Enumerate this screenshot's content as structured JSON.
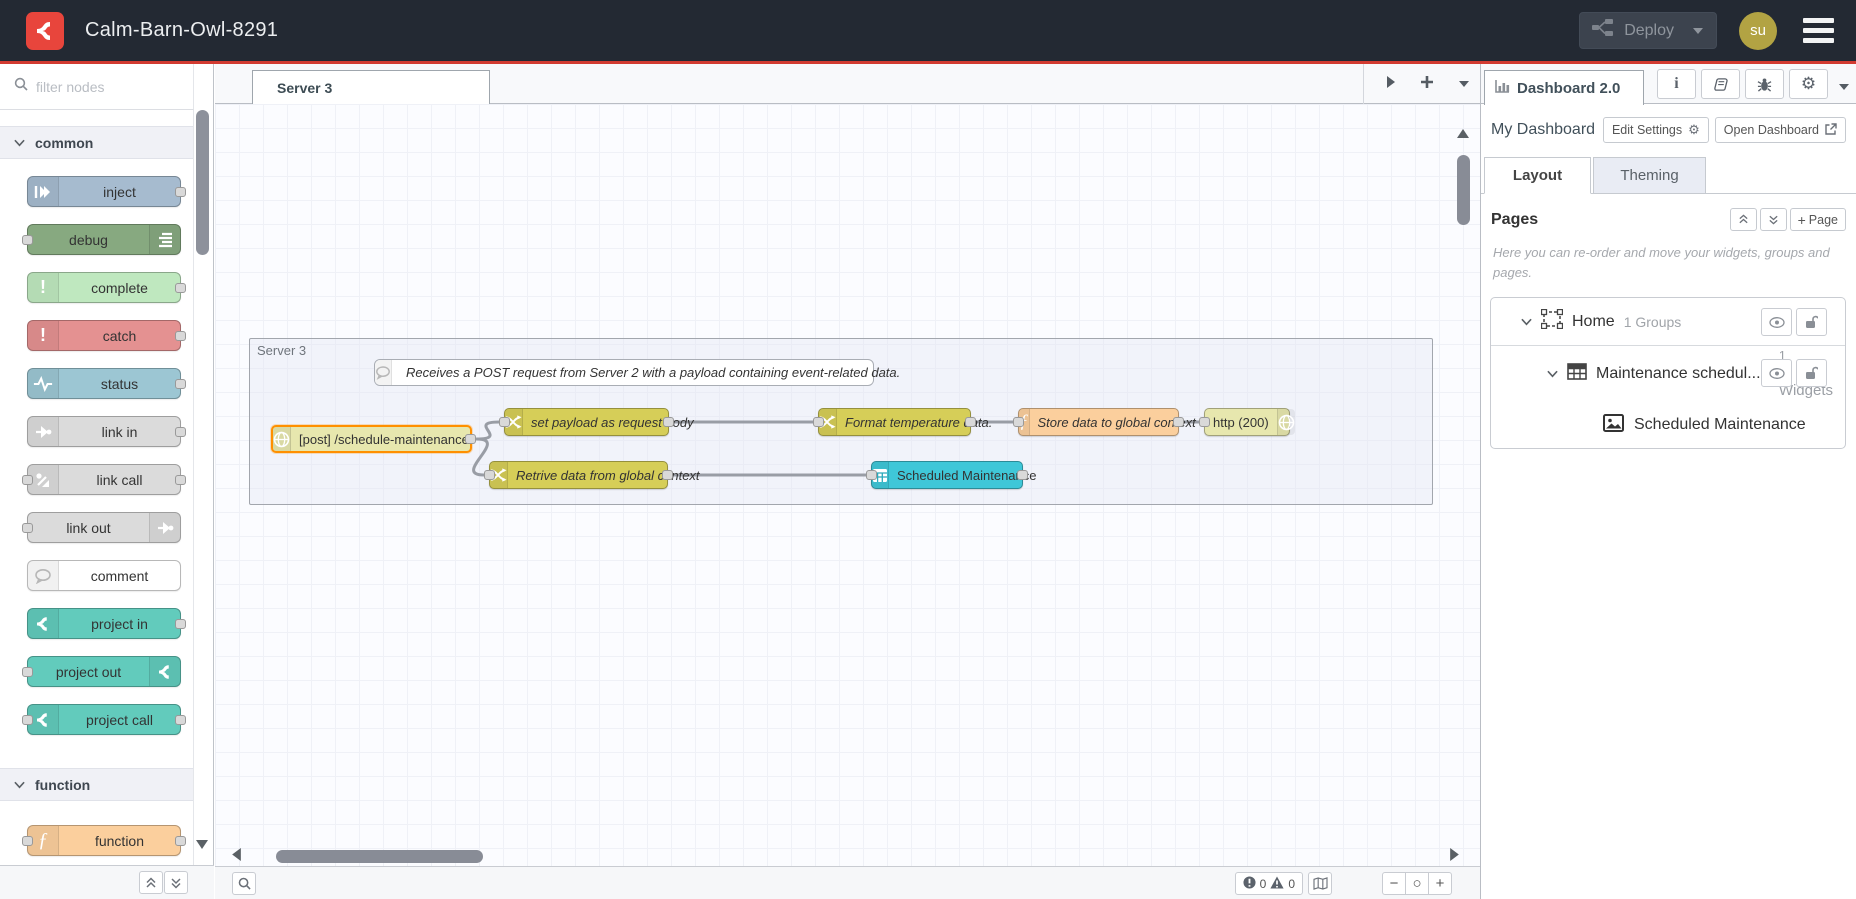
{
  "header": {
    "title": "Calm-Barn-Owl-8291",
    "deploy_label": "Deploy",
    "user_initials": "su"
  },
  "palette": {
    "filter_placeholder": "filter nodes",
    "categories": [
      {
        "label": "common",
        "nodes": [
          {
            "label": "inject",
            "color": "#a6bbcf",
            "icon": "arrow-in-icon"
          },
          {
            "label": "debug",
            "color": "#87a980",
            "icon": "list-icon"
          },
          {
            "label": "complete",
            "color": "#bfe8bf",
            "icon": "exclamation-icon"
          },
          {
            "label": "catch",
            "color": "#e49191",
            "icon": "exclamation-icon"
          },
          {
            "label": "status",
            "color": "#9cc6d3",
            "icon": "pulse-icon"
          },
          {
            "label": "link in",
            "color": "#dbdbdb",
            "icon": "link-arrow-icon"
          },
          {
            "label": "link call",
            "color": "#dbdbdb",
            "icon": "link-arrow-icon"
          },
          {
            "label": "link out",
            "color": "#dbdbdb",
            "icon": "link-arrow-icon"
          },
          {
            "label": "comment",
            "color": "#ffffff",
            "icon": "speech-bubble-icon"
          },
          {
            "label": "project in",
            "color": "#62cbbc",
            "icon": "node-red-logo-icon"
          },
          {
            "label": "project out",
            "color": "#62cbbc",
            "icon": "node-red-logo-icon"
          },
          {
            "label": "project call",
            "color": "#62cbbc",
            "icon": "node-red-logo-icon"
          }
        ]
      },
      {
        "label": "function",
        "nodes": [
          {
            "label": "function",
            "color": "#fbcf9d",
            "icon": "function-icon"
          }
        ]
      }
    ]
  },
  "workspace": {
    "tab_label": "Server 3",
    "group_label": "Server 3",
    "comment_text": "Receives a POST request from Server 2 with a payload containing event-related data.",
    "nodes": [
      {
        "label": "[post] /schedule-maintenance",
        "color": "#e7e7ae",
        "icon": "globe-icon",
        "selected": true
      },
      {
        "label": "set payload as request body",
        "color": "#d6ce58",
        "icon": "shuffle-icon"
      },
      {
        "label": "Format temperature data.",
        "color": "#d6ce58",
        "icon": "shuffle-icon"
      },
      {
        "label": "Store data to global context",
        "color": "#fbcf9d",
        "icon": "function-icon"
      },
      {
        "label": "http (200)",
        "color": "#e7e7ae",
        "icon": "globe-icon"
      },
      {
        "label": "Retrive data from global context",
        "color": "#d6ce58",
        "icon": "shuffle-icon"
      },
      {
        "label": "Scheduled Maintenance",
        "color": "#3fc7d8",
        "icon": "table-icon"
      }
    ],
    "footer": {
      "error_count": "0",
      "warning_count": "0",
      "zoom_out": "−",
      "zoom_reset": "○",
      "zoom_in": "+"
    }
  },
  "sidebar": {
    "tab_label": "Dashboard 2.0",
    "dashboard_title": "My Dashboard",
    "edit_settings_label": "Edit Settings",
    "open_dashboard_label": "Open Dashboard",
    "tabs": {
      "layout": "Layout",
      "theming": "Theming"
    },
    "pages_title": "Pages",
    "add_page_label": "Page",
    "add_page_plus": "+",
    "help_text": "Here you can re-order and move your widgets, groups and pages.",
    "tree": {
      "page": {
        "label": "Home",
        "meta": "1 Groups"
      },
      "group": {
        "label": "Maintenance schedul...",
        "count": "1",
        "count_word": "Widgets"
      },
      "widget": {
        "label": "Scheduled Maintenance"
      }
    }
  },
  "icons": {
    "logo": "node-red-logo",
    "deploy": "deploy-nodes-glyph",
    "menu": "hamburger",
    "search": "magnifier",
    "settings": "⚙",
    "info": "i",
    "gear_small": "⚙"
  },
  "colors": {
    "header_bg": "#232933",
    "accent_red": "#d23b31",
    "logo_red": "#e8453c",
    "selection_orange": "#ff9000",
    "wire_gray": "#999da5"
  }
}
